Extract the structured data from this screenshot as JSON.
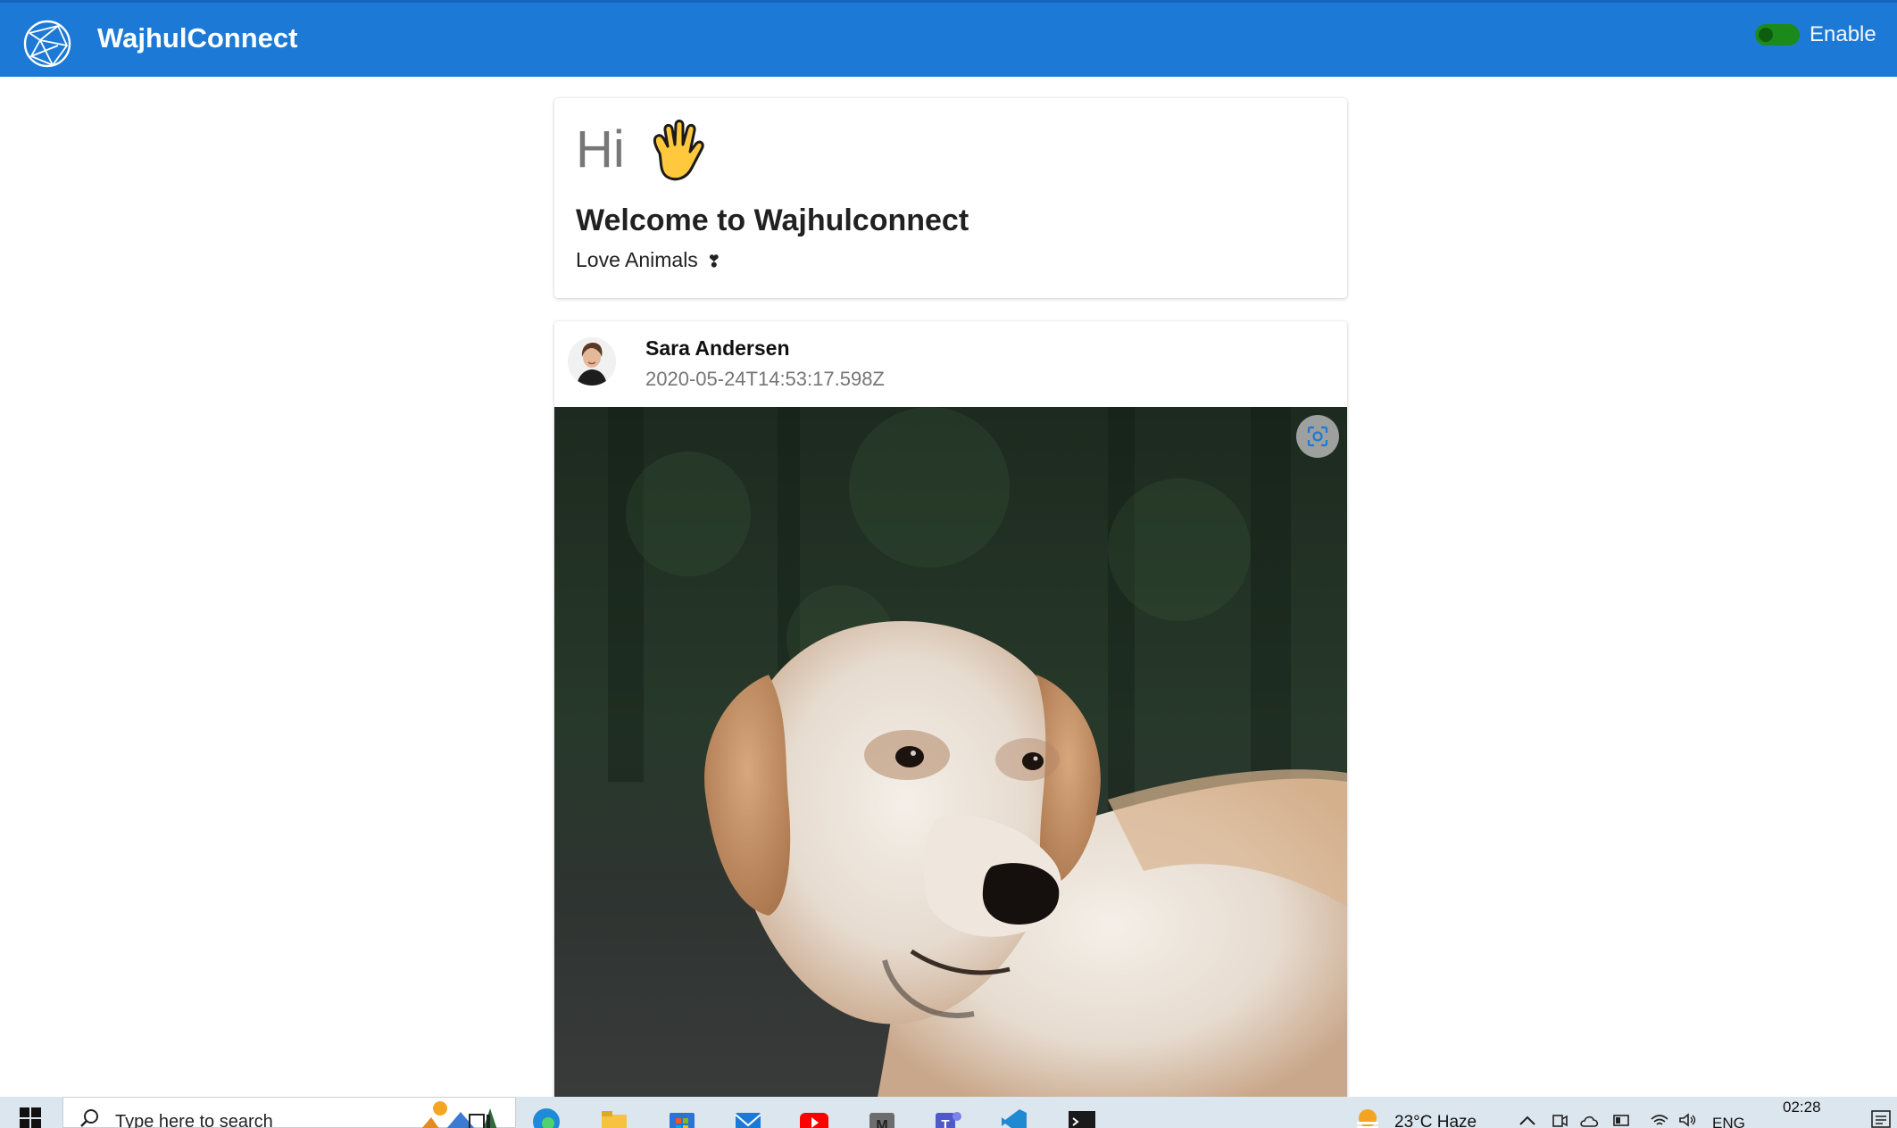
{
  "app": {
    "brand": "WajhulConnect",
    "toggle_label": "Enable",
    "toggle_on": true,
    "colors": {
      "appbar": "#1c7ad6",
      "toggle": "#1b8a1b"
    }
  },
  "welcome": {
    "greeting": "Hi",
    "greeting_icon": "waving-hand-icon",
    "title": "Welcome to Wajhulconnect",
    "subtitle": "Love Animals",
    "subtitle_mark": "❣"
  },
  "post": {
    "author": "Sara Andersen",
    "timestamp": "2020-05-24T14:53:17.598Z",
    "avatar_icon": "user-avatar",
    "image_icon": "dog-photo",
    "action_icon": "visual-search-icon"
  },
  "taskbar": {
    "search_placeholder": "Type here to search",
    "weather": "23°C  Haze",
    "language": "ENG",
    "time": "02:28",
    "pinned": [
      "windows-start-icon",
      "task-view-icon",
      "edge-icon",
      "file-explorer-icon",
      "microsoft-store-icon",
      "mail-icon",
      "youtube-icon",
      "gmail-icon",
      "teams-icon",
      "vscode-icon",
      "terminal-icon"
    ]
  }
}
